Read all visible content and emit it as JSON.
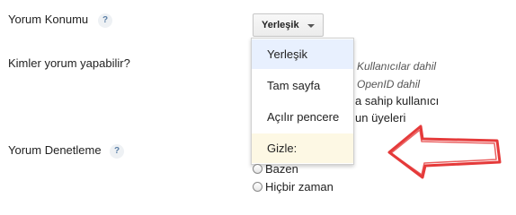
{
  "settings": {
    "comment_location": {
      "label": "Yorum Konumu",
      "help": "?"
    },
    "who_can_comment": {
      "label": "Kimler yorum yapabilir?"
    },
    "comment_moderation": {
      "label": "Yorum Denetleme",
      "help": "?"
    }
  },
  "dropdown": {
    "selected": "Yerleşik",
    "options": [
      {
        "label": "Yerleşik",
        "highlighted": true
      },
      {
        "label": "Tam sayfa",
        "highlighted": false
      },
      {
        "label": "Açılır pencere",
        "highlighted": false
      },
      {
        "label": "Gizle:",
        "highlighted": false
      }
    ]
  },
  "background_options": {
    "line1": "Kullanıcılar dahil",
    "line2": "OpenID dahil",
    "line3": "a sahip kullanıcı",
    "line4": "un üyeleri"
  },
  "moderation_options": [
    {
      "label": "Bazen"
    },
    {
      "label": "Hiçbir zaman"
    }
  ],
  "colors": {
    "highlight_first": "#e8f0fe",
    "highlight_last": "#fdf8e4",
    "arrow": "#e53a3a"
  }
}
